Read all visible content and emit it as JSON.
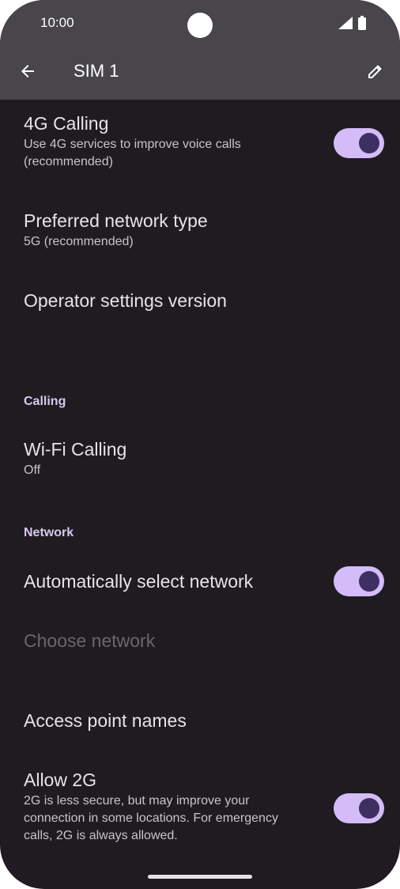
{
  "status_bar": {
    "time": "10:00"
  },
  "app_bar": {
    "title": "SIM 1"
  },
  "settings": {
    "calling_4g": {
      "title": "4G Calling",
      "subtitle_line1": "Use 4G services to improve voice calls",
      "subtitle_line2": "(recommended)",
      "toggle_on": true
    },
    "network_type": {
      "title": "Preferred network type",
      "subtitle": "5G (recommended)"
    },
    "operator_version": {
      "title": "Operator settings version"
    },
    "calling_section": "Calling",
    "wifi_calling": {
      "title": "Wi-Fi Calling",
      "subtitle": "Off"
    },
    "network_section": "Network",
    "auto_select": {
      "title": "Automatically select network",
      "toggle_on": true
    },
    "choose_network": {
      "title": "Choose network",
      "enabled": false
    },
    "apn": {
      "title": "Access point names"
    },
    "allow_2g": {
      "title": "Allow 2G",
      "subtitle_line1": "2G is less secure, but may improve your",
      "subtitle_line2": "connection in some locations. For emergency",
      "subtitle_line3": "calls, 2G is always allowed.",
      "toggle_on": true
    }
  },
  "colors": {
    "background": "#1f1b20",
    "toolbar": "#48464a",
    "switch_track": "#d3bcf7",
    "switch_thumb": "#3e2f63",
    "section_header": "#d9c8ee"
  }
}
